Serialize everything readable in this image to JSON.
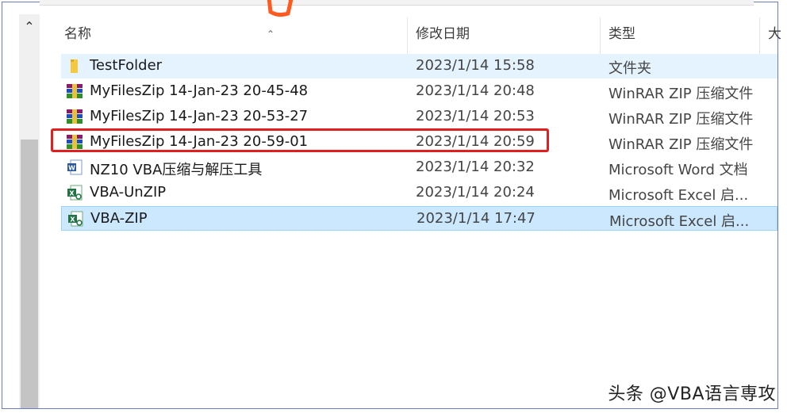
{
  "columns": {
    "name": "名称",
    "date": "修改日期",
    "type": "类型",
    "size_partial": "大"
  },
  "files": [
    {
      "name": "TestFolder",
      "date": "2023/1/14 15:58",
      "type": "文件夹",
      "icon": "folder-icon",
      "state": "hover"
    },
    {
      "name": "MyFilesZip  14-Jan-23 20-45-48",
      "date": "2023/1/14 20:48",
      "type": "WinRAR ZIP 压缩文件",
      "icon": "winrar-zip-icon",
      "state": "normal"
    },
    {
      "name": "MyFilesZip  14-Jan-23 20-53-27",
      "date": "2023/1/14 20:53",
      "type": "WinRAR ZIP 压缩文件",
      "icon": "winrar-zip-icon",
      "state": "normal"
    },
    {
      "name": "MyFilesZip  14-Jan-23 20-59-01",
      "date": "2023/1/14 20:59",
      "type": "WinRAR ZIP 压缩文件",
      "icon": "winrar-zip-icon",
      "state": "highlighted"
    },
    {
      "name": "NZ10 VBA压缩与解压工具",
      "date": "2023/1/14 20:32",
      "type": "Microsoft Word 文档",
      "icon": "word-doc-icon",
      "state": "normal"
    },
    {
      "name": "VBA-UnZIP",
      "date": "2023/1/14 20:24",
      "type": "Microsoft Excel 启...",
      "icon": "excel-macro-icon",
      "state": "normal"
    },
    {
      "name": "VBA-ZIP",
      "date": "2023/1/14 17:47",
      "type": "Microsoft Excel 启...",
      "icon": "excel-macro-icon",
      "state": "selected"
    }
  ],
  "watermark": "头条 @VBA语言専攻",
  "colors": {
    "highlight_border": "#e02020",
    "selected_bg": "#cce8ff",
    "hover_bg": "#e5f3ff"
  }
}
